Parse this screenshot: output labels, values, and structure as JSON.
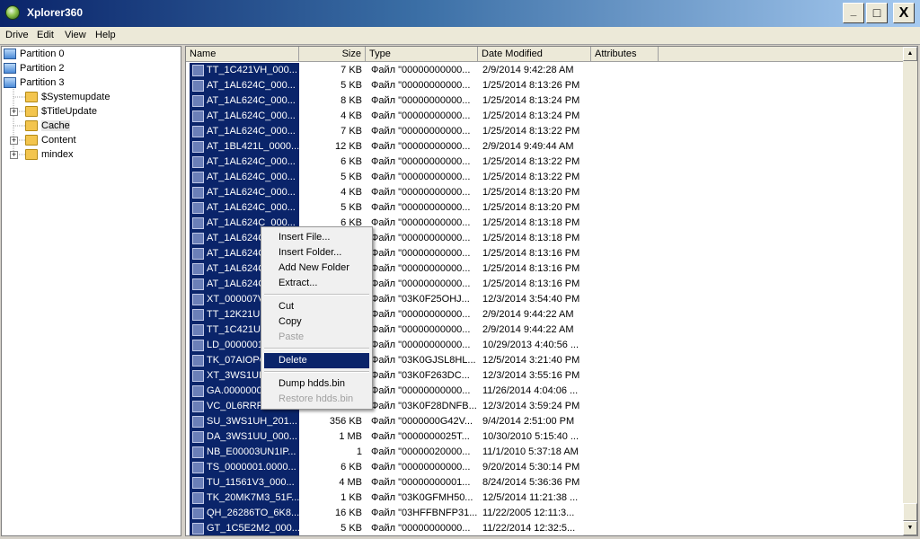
{
  "window": {
    "title": "Xplorer360",
    "min_label": "_",
    "max_label": "□",
    "close_label": "X"
  },
  "menu": {
    "items": [
      "Drive",
      "Edit",
      "View",
      "Help"
    ]
  },
  "tree": {
    "partitions": [
      "Partition 0",
      "Partition 2",
      "Partition 3"
    ],
    "folders": [
      "$Systemupdate",
      "$TitleUpdate",
      "Cache",
      "Content",
      "mindex"
    ]
  },
  "columns": [
    "Name",
    "Size",
    "Type",
    "Date Modified",
    "Attributes"
  ],
  "files": [
    {
      "name": "TT_1C421VH_000...",
      "size": "7 KB",
      "type": "Файл \"00000000000...",
      "date": "2/9/2014 9:42:28 AM"
    },
    {
      "name": "AT_1AL624C_000...",
      "size": "5 KB",
      "type": "Файл \"00000000000...",
      "date": "1/25/2014 8:13:26 PM"
    },
    {
      "name": "AT_1AL624C_000...",
      "size": "8 KB",
      "type": "Файл \"00000000000...",
      "date": "1/25/2014 8:13:24 PM"
    },
    {
      "name": "AT_1AL624C_000...",
      "size": "4 KB",
      "type": "Файл \"00000000000...",
      "date": "1/25/2014 8:13:24 PM"
    },
    {
      "name": "AT_1AL624C_000...",
      "size": "7 KB",
      "type": "Файл \"00000000000...",
      "date": "1/25/2014 8:13:22 PM"
    },
    {
      "name": "AT_1BL421L_0000...",
      "size": "12 KB",
      "type": "Файл \"00000000000...",
      "date": "2/9/2014 9:49:44 AM"
    },
    {
      "name": "AT_1AL624C_000...",
      "size": "6 KB",
      "type": "Файл \"00000000000...",
      "date": "1/25/2014 8:13:22 PM"
    },
    {
      "name": "AT_1AL624C_000...",
      "size": "5 KB",
      "type": "Файл \"00000000000...",
      "date": "1/25/2014 8:13:22 PM"
    },
    {
      "name": "AT_1AL624C_000...",
      "size": "4 KB",
      "type": "Файл \"00000000000...",
      "date": "1/25/2014 8:13:20 PM"
    },
    {
      "name": "AT_1AL624C_000...",
      "size": "5 KB",
      "type": "Файл \"00000000000...",
      "date": "1/25/2014 8:13:20 PM"
    },
    {
      "name": "AT_1AL624C_000...",
      "size": "6 KB",
      "type": "Файл \"00000000000...",
      "date": "1/25/2014 8:13:18 PM"
    },
    {
      "name": "AT_1AL624C",
      "size": "",
      "type": "Файл \"00000000000...",
      "date": "1/25/2014 8:13:18 PM"
    },
    {
      "name": "AT_1AL624C",
      "size": "",
      "type": "Файл \"00000000000...",
      "date": "1/25/2014 8:13:16 PM"
    },
    {
      "name": "AT_1AL624C",
      "size": "",
      "type": "Файл \"00000000000...",
      "date": "1/25/2014 8:13:16 PM"
    },
    {
      "name": "AT_1AL624C",
      "size": "",
      "type": "Файл \"00000000000...",
      "date": "1/25/2014 8:13:16 PM"
    },
    {
      "name": "XT_000007V",
      "size": "",
      "type": "Файл \"03K0F25OHJ...",
      "date": "12/3/2014 3:54:40 PM"
    },
    {
      "name": "TT_12K21UR",
      "size": "",
      "type": "Файл \"00000000000...",
      "date": "2/9/2014 9:44:22 AM"
    },
    {
      "name": "TT_1C421UL",
      "size": "",
      "type": "Файл \"00000000000...",
      "date": "2/9/2014 9:44:22 AM"
    },
    {
      "name": "LD_0000001",
      "size": "",
      "type": "Файл \"00000000000...",
      "date": "10/29/2013 4:40:56 ..."
    },
    {
      "name": "TK_07AIOPC",
      "size": "",
      "type": "Файл \"03K0GJSL8HL...",
      "date": "12/5/2014 3:21:40 PM"
    },
    {
      "name": "XT_3WS1UH",
      "size": "",
      "type": "Файл \"03K0F263DC...",
      "date": "12/3/2014 3:55:16 PM"
    },
    {
      "name": "GA.0000000",
      "size": "",
      "type": "Файл \"00000000000...",
      "date": "11/26/2014 4:04:06 ..."
    },
    {
      "name": "VC_0L6RRFC",
      "size": "",
      "type": "Файл \"03K0F28DNFB...",
      "date": "12/3/2014 3:59:24 PM"
    },
    {
      "name": "SU_3WS1UH_201...",
      "size": "356 KB",
      "type": "Файл \"0000000G42V...",
      "date": "9/4/2014 2:51:00 PM"
    },
    {
      "name": "DA_3WS1UU_000...",
      "size": "1 MB",
      "type": "Файл \"0000000025T...",
      "date": "10/30/2010 5:15:40 ..."
    },
    {
      "name": "NB_E00003UN1IP...",
      "size": "1",
      "type": "Файл \"00000020000...",
      "date": "11/1/2010 5:37:18 AM"
    },
    {
      "name": "TS_0000001.0000...",
      "size": "6 KB",
      "type": "Файл \"00000000000...",
      "date": "9/20/2014 5:30:14 PM"
    },
    {
      "name": "TU_11561V3_000...",
      "size": "4 MB",
      "type": "Файл \"00000000001...",
      "date": "8/24/2014 5:36:36 PM"
    },
    {
      "name": "TK_20MK7M3_51F...",
      "size": "1 KB",
      "type": "Файл \"03K0GFMH50...",
      "date": "12/5/2014 11:21:38 ..."
    },
    {
      "name": "QH_26286TO_6K8...",
      "size": "16 KB",
      "type": "Файл \"03HFFBNFP31...",
      "date": "11/22/2005 12:11:3..."
    },
    {
      "name": "GT_1C5E2M2_000...",
      "size": "5 KB",
      "type": "Файл \"00000000000...",
      "date": "11/22/2014 12:32:5..."
    }
  ],
  "context_menu": {
    "groups": [
      [
        {
          "label": "Insert File...",
          "enabled": true
        },
        {
          "label": "Insert Folder...",
          "enabled": true
        },
        {
          "label": "Add New Folder",
          "enabled": true
        },
        {
          "label": "Extract...",
          "enabled": true
        }
      ],
      [
        {
          "label": "Cut",
          "enabled": true
        },
        {
          "label": "Copy",
          "enabled": true
        },
        {
          "label": "Paste",
          "enabled": false
        }
      ],
      [
        {
          "label": "Delete",
          "enabled": true,
          "highlighted": true
        }
      ],
      [
        {
          "label": "Dump hdds.bin",
          "enabled": true
        },
        {
          "label": "Restore hdds.bin",
          "enabled": false
        }
      ]
    ]
  },
  "colors": {
    "selection": "#0a246a",
    "title_start": "#0a246a",
    "title_end": "#a6caf0"
  }
}
